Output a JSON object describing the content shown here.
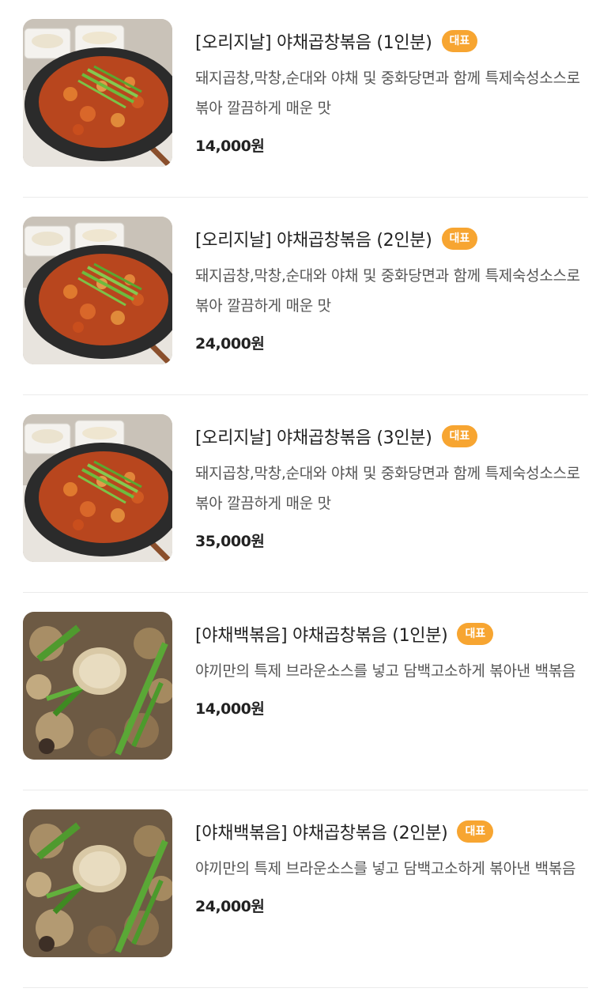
{
  "menu": {
    "items": [
      {
        "title": "[오리지날] 야채곱창볶음 (1인분)",
        "badge": "대표",
        "description": "돼지곱창,막창,순대와 야채 및 중화당면과 함께 특제숙성소스로 볶아 깔끔하게 매운 맛",
        "price": "14,000원",
        "photo": "spicy-gopchang-photo"
      },
      {
        "title": "[오리지날] 야채곱창볶음 (2인분)",
        "badge": "대표",
        "description": "돼지곱창,막창,순대와 야채 및 중화당면과 함께 특제숙성소스로 볶아 깔끔하게 매운 맛",
        "price": "24,000원",
        "photo": "spicy-gopchang-photo"
      },
      {
        "title": "[오리지날] 야채곱창볶음 (3인분)",
        "badge": "대표",
        "description": "돼지곱창,막창,순대와 야채 및 중화당면과 함께 특제숙성소스로 볶아 깔끔하게 매운 맛",
        "price": "35,000원",
        "photo": "spicy-gopchang-photo"
      },
      {
        "title": "[야채백볶음] 야채곱창볶음 (1인분)",
        "badge": "대표",
        "description": "야끼만의 특제 브라운소스를 넣고 담백고소하게 볶아낸 백볶음",
        "price": "14,000원",
        "photo": "white-gopchang-photo"
      },
      {
        "title": "[야채백볶음] 야채곱창볶음 (2인분)",
        "badge": "대표",
        "description": "야끼만의 특제 브라운소스를 넣고 담백고소하게 볶아낸 백볶음",
        "price": "24,000원",
        "photo": "white-gopchang-photo"
      }
    ]
  },
  "colors": {
    "badge": "#f7a531",
    "divider": "#ebebeb"
  }
}
